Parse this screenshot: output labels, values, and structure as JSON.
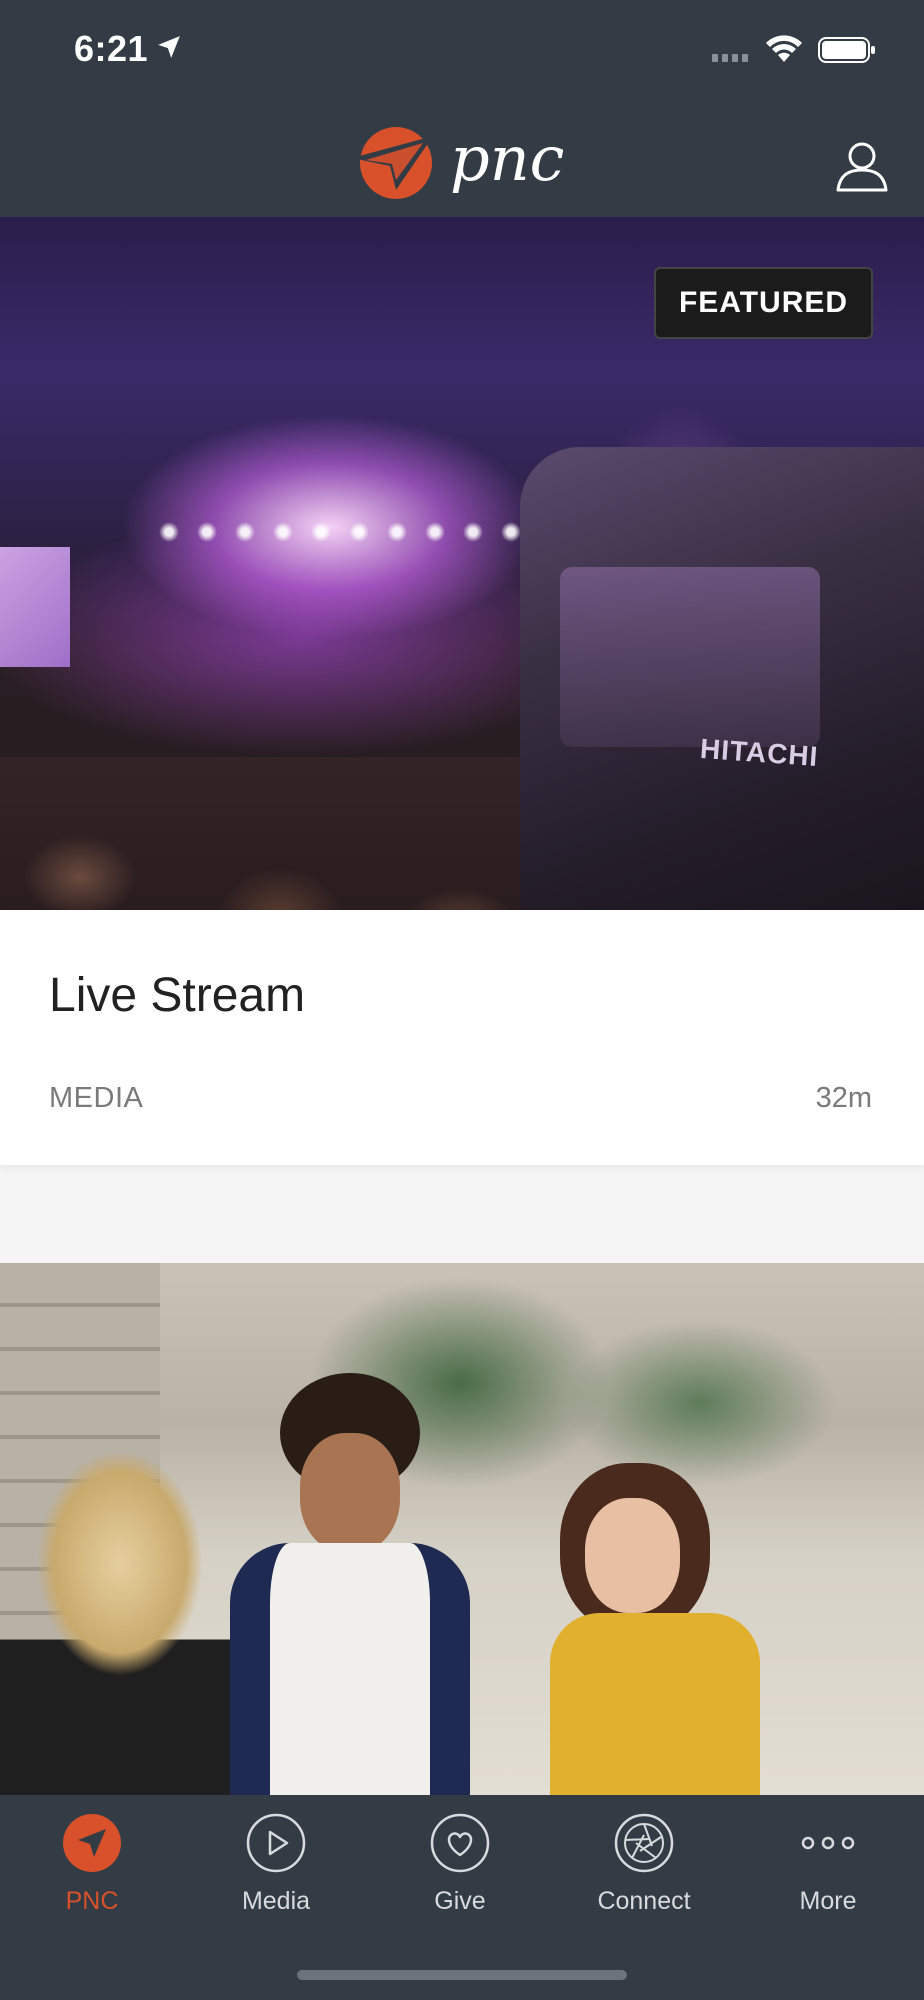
{
  "status_bar": {
    "time": "6:21",
    "icons": [
      "location-arrow-icon",
      "cellular-signal-icon",
      "wifi-icon",
      "battery-icon"
    ]
  },
  "header": {
    "logo_text": "pnc",
    "profile_icon": "user-profile-icon"
  },
  "featured_card": {
    "badge": "FEATURED",
    "title": "Live Stream",
    "category": "MEDIA",
    "duration": "32m",
    "image_description_icon": "concert-stage-photo"
  },
  "second_card": {
    "image_icon": "people-talking-photo"
  },
  "tab_bar": {
    "tabs": [
      {
        "label": "PNC",
        "icon": "navigation-arrow-icon",
        "active": true
      },
      {
        "label": "Media",
        "icon": "play-circle-icon",
        "active": false
      },
      {
        "label": "Give",
        "icon": "heart-circle-icon",
        "active": false
      },
      {
        "label": "Connect",
        "icon": "aperture-icon",
        "active": false
      },
      {
        "label": "More",
        "icon": "more-dots-icon",
        "active": false
      }
    ]
  },
  "colors": {
    "header_bg": "#333c45",
    "accent": "#d9512b",
    "tab_label": "#d7dbe0"
  }
}
